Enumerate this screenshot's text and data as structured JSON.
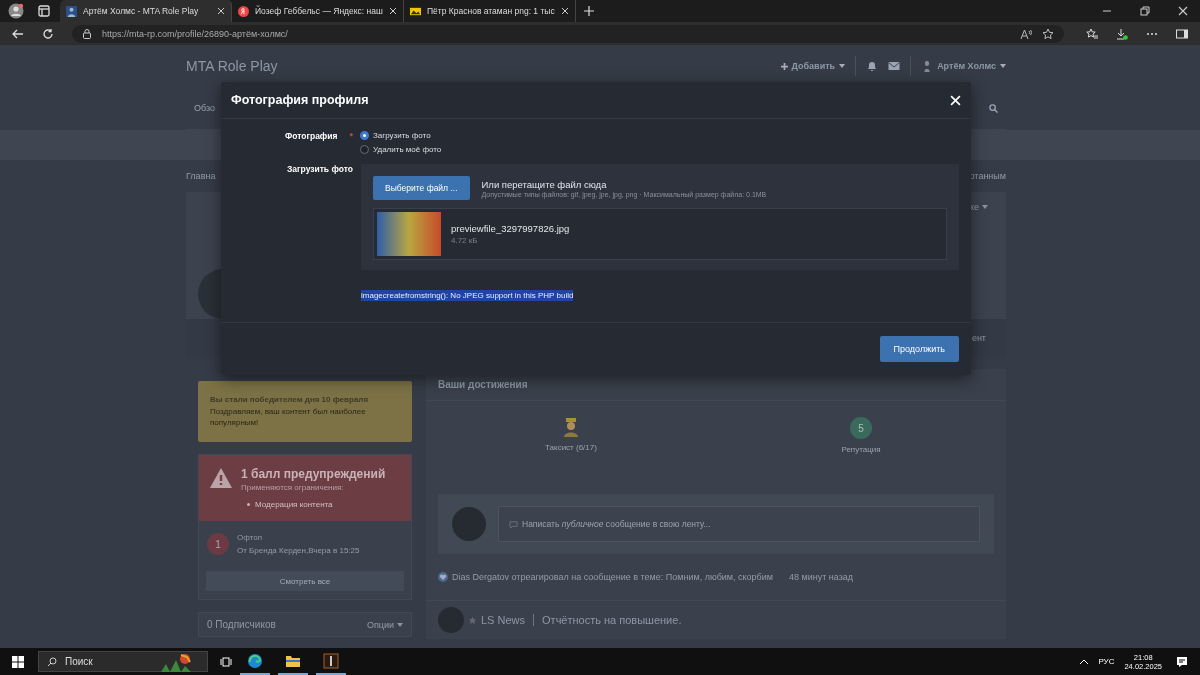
{
  "browser": {
    "tabs": [
      {
        "title": "Артём Холмс - MTA Role Play",
        "kind": "site",
        "selected": true
      },
      {
        "title": "Йозеф Геббельс — Яндекс: наш",
        "kind": "yandex",
        "selected": false
      },
      {
        "title": "Пётр Краснов атаман png: 1 тыс",
        "kind": "images",
        "selected": false
      }
    ],
    "address": "https://mta-rp.com/profile/26890-артём-холмс/"
  },
  "site": {
    "title": "MTA Role Play",
    "add_label": "Добавить",
    "user": "Артём Холмс",
    "nav_fragment": "Обзо",
    "breadcrumb_left": "Главна",
    "breadcrumb_right": "отанным",
    "cover_options_fragment": "ке",
    "cover_button_fragment": "ент"
  },
  "modal": {
    "title": "Фотография профиля",
    "photo_field": {
      "label": "Фотография",
      "required_mark": "*",
      "options": [
        {
          "label": "Загрузить фото",
          "selected": true
        },
        {
          "label": "Удалить моё фото",
          "selected": false
        }
      ]
    },
    "upload_field": {
      "label": "Загрузить фото",
      "button": "Выберите файл ...",
      "drop_text": "Или перетащите файл сюда",
      "hint": "Допустимые типы файлов: gif, jpeg, jpe, jpg, png · Максимальный размер файла: 0.1MB",
      "file": {
        "name": "previewfile_3297997826.jpg",
        "size": "4.72 кБ"
      }
    },
    "error": "imagecreatefromstring(): No JPEG support in this PHP build",
    "submit": "Продолжить"
  },
  "sidebar": {
    "notice": {
      "title": "Вы стали победителем дня 10 февраля",
      "text": "Поздравляем, ваш контент был наиболее популярным!"
    },
    "warning": {
      "title": "1 балл предупреждений",
      "subtitle": "Применяются ограничения:",
      "items": [
        "Модерация контента"
      ]
    },
    "warning_entries": [
      {
        "number": "1",
        "title": "Офтоп",
        "meta": "От Бренда Керден,Вчера в 15:25"
      }
    ],
    "view_all": "Смотреть все",
    "followers": {
      "title": "0 Подписчиков",
      "options": "Опции"
    }
  },
  "main": {
    "achievements_title": "Ваши достижения",
    "achievements": [
      {
        "kind": "icon",
        "label": "Таксист (6/17)"
      },
      {
        "kind": "badge",
        "value": "5",
        "label": "Репутация"
      }
    ],
    "composer": {
      "placeholder": "Написать *публичное* сообщение в свою ленту..."
    },
    "activity": {
      "text": "Dias Dergatov отреагировал на сообщение в теме: Помним, любим, скорбим",
      "time": "48 минут назад"
    },
    "post": {
      "author": "LS News",
      "title": "Отчётность на повышение."
    }
  },
  "taskbar": {
    "search_placeholder": "Поиск",
    "apps": [
      {
        "kind": "edge"
      },
      {
        "kind": "folder"
      },
      {
        "kind": "app"
      }
    ],
    "language": "РУС",
    "time": "21:08",
    "date": "24.02.2025"
  }
}
